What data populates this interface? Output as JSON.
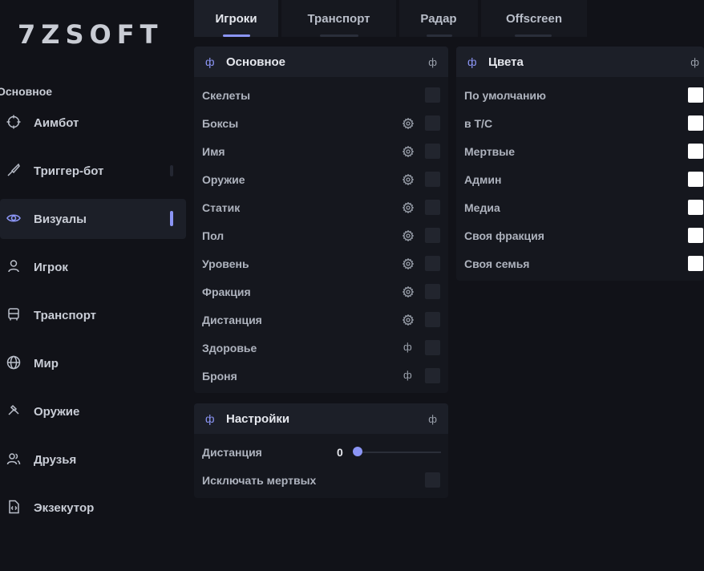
{
  "brand": {
    "logo": "7ZSOFT"
  },
  "sidebar": {
    "section_label": "Основное",
    "items": [
      {
        "label": "Аимбот",
        "icon": "crosshair-icon"
      },
      {
        "label": "Триггер-бот",
        "icon": "knife-icon"
      },
      {
        "label": "Визуалы",
        "icon": "eye-icon",
        "active": true
      },
      {
        "label": "Игрок",
        "icon": "user-icon"
      },
      {
        "label": "Транспорт",
        "icon": "bus-icon"
      },
      {
        "label": "Мир",
        "icon": "globe-icon"
      },
      {
        "label": "Оружие",
        "icon": "hammer-icon"
      },
      {
        "label": "Друзья",
        "icon": "users-icon"
      },
      {
        "label": "Экзекутор",
        "icon": "code-file-icon"
      }
    ]
  },
  "tabs": [
    {
      "label": "Игроки",
      "active": true
    },
    {
      "label": "Транспорт"
    },
    {
      "label": "Радар"
    },
    {
      "label": "Offscreen"
    }
  ],
  "panels": {
    "main": {
      "title": "Основное",
      "phi_left": "ф",
      "phi_right": "ф",
      "rows": [
        {
          "label": "Скелеты",
          "extra": "none"
        },
        {
          "label": "Боксы",
          "extra": "gear"
        },
        {
          "label": "Имя",
          "extra": "gear"
        },
        {
          "label": "Оружие",
          "extra": "gear"
        },
        {
          "label": "Статик",
          "extra": "gear"
        },
        {
          "label": "Пол",
          "extra": "gear"
        },
        {
          "label": "Уровень",
          "extra": "gear"
        },
        {
          "label": "Фракция",
          "extra": "gear"
        },
        {
          "label": "Дистанция",
          "extra": "gear"
        },
        {
          "label": "Здоровье",
          "extra": "phi",
          "extra_text": "ф"
        },
        {
          "label": "Броня",
          "extra": "phi",
          "extra_text": "ф"
        }
      ]
    },
    "settings": {
      "title": "Настройки",
      "phi_left": "ф",
      "phi_right": "ф",
      "distance_label": "Дистанция",
      "distance_value": "0",
      "distance_fraction": 0.0,
      "exclude_dead_label": "Исключать мертвых"
    },
    "colors": {
      "title": "Цвета",
      "phi_left": "ф",
      "phi_right": "ф",
      "rows": [
        {
          "label": "По умолчанию",
          "color": "#ffffff"
        },
        {
          "label": "в Т/С",
          "color": "#ffffff"
        },
        {
          "label": "Мертвые",
          "color": "#ffffff"
        },
        {
          "label": "Админ",
          "color": "#ffffff"
        },
        {
          "label": "Медиа",
          "color": "#ffffff"
        },
        {
          "label": "Своя фракция",
          "color": "#ffffff"
        },
        {
          "label": "Своя семья",
          "color": "#ffffff"
        }
      ]
    }
  },
  "theme": {
    "accent": "#8b95f5",
    "background": "#111218",
    "panel": "#15171e",
    "header": "#1c1f28"
  }
}
